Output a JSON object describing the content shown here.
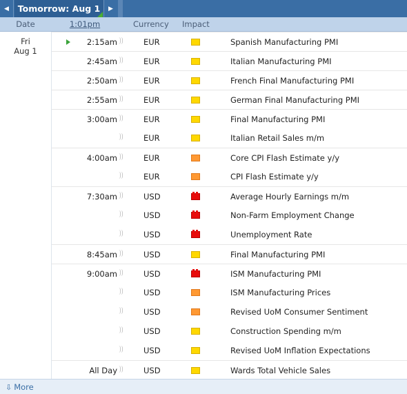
{
  "nav": {
    "prev_icon": "chevron-left-icon",
    "next_icon": "chevron-right-icon",
    "title": "Tomorrow: Aug 1"
  },
  "header": {
    "date": "Date",
    "time": "1:01pm",
    "currency": "Currency",
    "impact": "Impact"
  },
  "day": {
    "weekday": "Fri",
    "date": "Aug 1"
  },
  "impact_colors": {
    "low": "#ffd800",
    "medium": "#ff9933",
    "high": "#e80c0c"
  },
  "rows": [
    {
      "time": "2:15am",
      "currency": "EUR",
      "impact": "low",
      "event": "Spanish Manufacturing PMI"
    },
    {
      "time": "2:45am",
      "currency": "EUR",
      "impact": "low",
      "event": "Italian Manufacturing PMI"
    },
    {
      "time": "2:50am",
      "currency": "EUR",
      "impact": "low",
      "event": "French Final Manufacturing PMI"
    },
    {
      "time": "2:55am",
      "currency": "EUR",
      "impact": "low",
      "event": "German Final Manufacturing PMI"
    },
    {
      "time": "3:00am",
      "currency": "EUR",
      "impact": "low",
      "event": "Final Manufacturing PMI"
    },
    {
      "time": "",
      "currency": "EUR",
      "impact": "low",
      "event": "Italian Retail Sales m/m"
    },
    {
      "time": "4:00am",
      "currency": "EUR",
      "impact": "medium",
      "event": "Core CPI Flash Estimate y/y"
    },
    {
      "time": "",
      "currency": "EUR",
      "impact": "medium",
      "event": "CPI Flash Estimate y/y"
    },
    {
      "time": "7:30am",
      "currency": "USD",
      "impact": "high",
      "event": "Average Hourly Earnings m/m"
    },
    {
      "time": "",
      "currency": "USD",
      "impact": "high",
      "event": "Non-Farm Employment Change"
    },
    {
      "time": "",
      "currency": "USD",
      "impact": "high",
      "event": "Unemployment Rate"
    },
    {
      "time": "8:45am",
      "currency": "USD",
      "impact": "low",
      "event": "Final Manufacturing PMI"
    },
    {
      "time": "9:00am",
      "currency": "USD",
      "impact": "high",
      "event": "ISM Manufacturing PMI"
    },
    {
      "time": "",
      "currency": "USD",
      "impact": "medium",
      "event": "ISM Manufacturing Prices"
    },
    {
      "time": "",
      "currency": "USD",
      "impact": "medium",
      "event": "Revised UoM Consumer Sentiment"
    },
    {
      "time": "",
      "currency": "USD",
      "impact": "low",
      "event": "Construction Spending m/m"
    },
    {
      "time": "",
      "currency": "USD",
      "impact": "low",
      "event": "Revised UoM Inflation Expectations"
    },
    {
      "time": "All Day",
      "currency": "USD",
      "impact": "low",
      "event": "Wards Total Vehicle Sales"
    }
  ],
  "footer": {
    "more_label": "More"
  }
}
